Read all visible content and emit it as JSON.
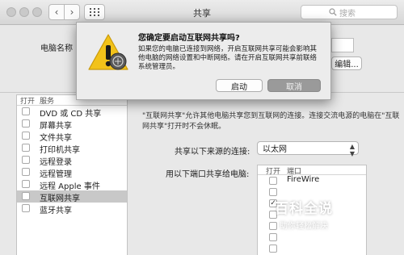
{
  "window": {
    "title": "共享",
    "search_placeholder": "搜索"
  },
  "top": {
    "computer_name_label": "电脑名称",
    "edit_button": "编辑..."
  },
  "services": {
    "header_on": "打开",
    "header_service": "服务",
    "items": [
      {
        "label": "DVD 或 CD 共享",
        "checked": false
      },
      {
        "label": "屏幕共享",
        "checked": false
      },
      {
        "label": "文件共享",
        "checked": false
      },
      {
        "label": "打印机共享",
        "checked": false
      },
      {
        "label": "远程登录",
        "checked": false
      },
      {
        "label": "远程管理",
        "checked": false
      },
      {
        "label": "远程 Apple 事件",
        "checked": false
      },
      {
        "label": "互联网共享",
        "checked": false,
        "selected": true
      },
      {
        "label": "蓝牙共享",
        "checked": false
      }
    ]
  },
  "detail": {
    "description": "\"互联网共享\"允许其他电脑共享您到互联网的连接。连接交流电源的电脑在\"互联网共享\"打开时不会休眠。",
    "share_from_label": "共享以下来源的连接:",
    "share_from_value": "以太网",
    "share_to_label": "用以下端口共享给电脑:",
    "ports_header_on": "打开",
    "ports_header_port": "端口",
    "ports": [
      {
        "label": "FireWire",
        "checked": false
      },
      {
        "label": "",
        "checked": false
      },
      {
        "label": "",
        "checked": true
      },
      {
        "label": "",
        "checked": false
      },
      {
        "label": "",
        "checked": false
      },
      {
        "label": "",
        "checked": false
      },
      {
        "label": "",
        "checked": false
      }
    ]
  },
  "dialog": {
    "title": "您确定要启动互联网共享吗?",
    "message": "如果您的电脑已连接到网络，开启互联网共享可能会影响其他电脑的网络设置和中断网络。请在开启互联网共享前联络系统管理员。",
    "confirm_button": "启动",
    "cancel_button": "取消"
  },
  "watermark": {
    "line1": "百科全说",
    "line2": "助你轻松解决"
  }
}
